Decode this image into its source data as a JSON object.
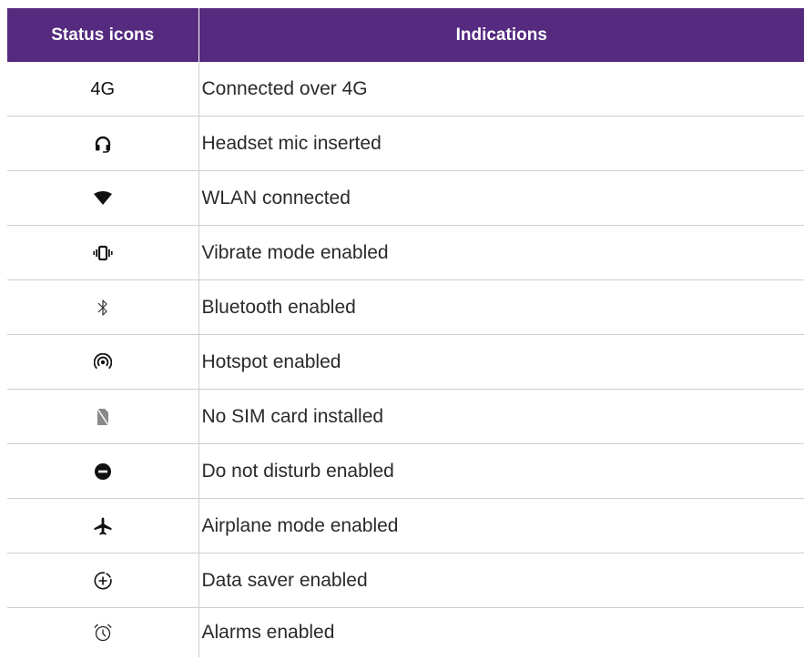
{
  "table": {
    "headers": [
      "Status icons",
      "Indications"
    ],
    "rows": [
      {
        "icon": "4g-text-icon",
        "icon_text": "4G",
        "indication": "Connected over 4G"
      },
      {
        "icon": "headset-icon",
        "indication": "Headset mic inserted"
      },
      {
        "icon": "wifi-icon",
        "indication": "WLAN connected"
      },
      {
        "icon": "vibrate-icon",
        "indication": "Vibrate mode enabled"
      },
      {
        "icon": "bluetooth-icon",
        "indication": "Bluetooth enabled"
      },
      {
        "icon": "hotspot-icon",
        "indication": "Hotspot enabled"
      },
      {
        "icon": "no-sim-icon",
        "indication": "No SIM card installed"
      },
      {
        "icon": "do-not-disturb-icon",
        "indication": "Do not disturb enabled"
      },
      {
        "icon": "airplane-icon",
        "indication": "Airplane mode enabled"
      },
      {
        "icon": "data-saver-icon",
        "indication": "Data saver  enabled"
      },
      {
        "icon": "alarm-icon",
        "indication": "Alarms enabled"
      }
    ]
  },
  "colors": {
    "header_bg": "#552a7f",
    "header_text": "#ffffff",
    "border": "#cfcfcf"
  }
}
